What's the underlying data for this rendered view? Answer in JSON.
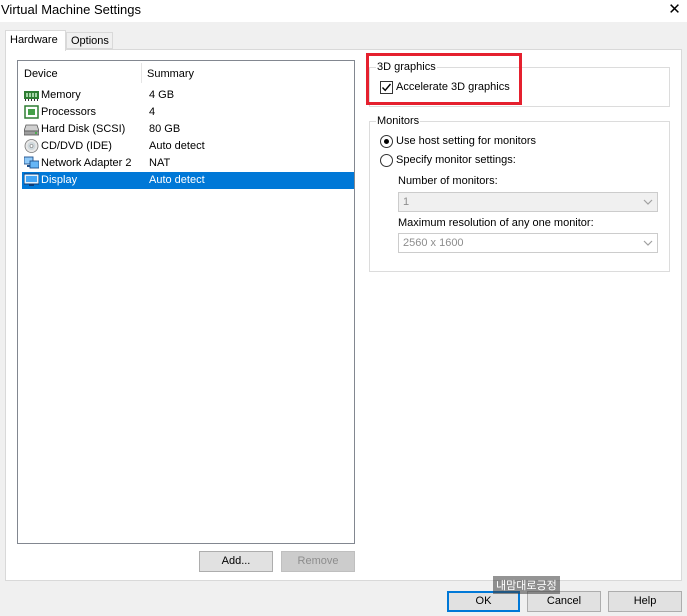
{
  "window": {
    "title": "Virtual Machine Settings",
    "close_symbol": "✕"
  },
  "tabs": [
    {
      "label": "Hardware",
      "active": true
    },
    {
      "label": "Options",
      "active": false
    }
  ],
  "device_list": {
    "columns": [
      "Device",
      "Summary"
    ],
    "rows": [
      {
        "device": "Memory",
        "summary": "4 GB",
        "icon": "memory-icon",
        "selected": false
      },
      {
        "device": "Processors",
        "summary": "4",
        "icon": "processor-icon",
        "selected": false
      },
      {
        "device": "Hard Disk (SCSI)",
        "summary": "80 GB",
        "icon": "hard-disk-icon",
        "selected": false
      },
      {
        "device": "CD/DVD (IDE)",
        "summary": "Auto detect",
        "icon": "cd-dvd-icon",
        "selected": false
      },
      {
        "device": "Network Adapter 2",
        "summary": "NAT",
        "icon": "network-adapter-icon",
        "selected": false
      },
      {
        "device": "Display",
        "summary": "Auto detect",
        "icon": "display-icon",
        "selected": true
      }
    ]
  },
  "list_buttons": {
    "add": "Add...",
    "remove": "Remove"
  },
  "graphics": {
    "group_label": "3D graphics",
    "accelerate_label": "Accelerate 3D graphics",
    "accelerate_checked": true
  },
  "monitors": {
    "group_label": "Monitors",
    "use_host_label": "Use host setting for monitors",
    "specify_label": "Specify monitor settings:",
    "selected_option": "use_host",
    "number_label": "Number of monitors:",
    "number_value": "1",
    "resolution_label": "Maximum resolution of any one monitor:",
    "resolution_value": "2560 x 1600"
  },
  "footer": {
    "ok": "OK",
    "cancel": "Cancel",
    "help": "Help"
  },
  "watermark": "내맘대로긍정",
  "colors": {
    "selection": "#0078d7",
    "highlight_box": "#e5202e"
  }
}
